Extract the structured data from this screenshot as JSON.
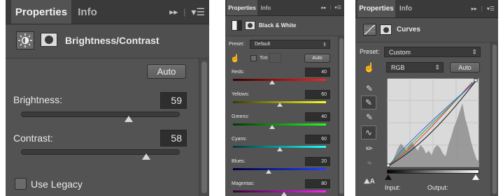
{
  "bc": {
    "tabs": [
      "Properties",
      "Info"
    ],
    "tab_controls": "▸▸",
    "title": "Brightness/Contrast",
    "auto_label": "Auto",
    "brightness_label": "Brightness:",
    "brightness_value": "59",
    "brightness_level": 0.68,
    "contrast_label": "Contrast:",
    "contrast_value": "58",
    "contrast_level": 0.79,
    "legacy_label": "Use Legacy"
  },
  "bw": {
    "tabs": [
      "Properties",
      "Info"
    ],
    "tab_controls": "▸▸",
    "title": "Black & White",
    "preset_label": "Preset:",
    "preset_value": "Default",
    "tint_label": "Tint",
    "auto_label": "Auto",
    "sliders": [
      {
        "label": "Reds:",
        "value": "40",
        "level": 0.42,
        "gradient": "linear-gradient(90deg,#3a0000,#ff2020)"
      },
      {
        "label": "Yellows:",
        "value": "60",
        "level": 0.5,
        "gradient": "linear-gradient(90deg,#3a3a00,#ffff20)"
      },
      {
        "label": "Greens:",
        "value": "40",
        "level": 0.42,
        "gradient": "linear-gradient(90deg,#003a00,#20ff20)"
      },
      {
        "label": "Cyans:",
        "value": "60",
        "level": 0.5,
        "gradient": "linear-gradient(90deg,#003a3a,#20ffff)"
      },
      {
        "label": "Blues:",
        "value": "20",
        "level": 0.38,
        "gradient": "linear-gradient(90deg,#00003a,#2040ff)"
      },
      {
        "label": "Magentas:",
        "value": "80",
        "level": 0.55,
        "gradient": "linear-gradient(90deg,#3a003a,#ff20ff)"
      }
    ]
  },
  "curves": {
    "tabs": [
      "Properties",
      "Info"
    ],
    "tab_controls": "▸▸",
    "title": "Curves",
    "preset_label": "Preset:",
    "preset_value": "Custom",
    "channel_value": "RGB",
    "auto_label": "Auto",
    "input_label": "Input:",
    "output_label": "Output:"
  }
}
